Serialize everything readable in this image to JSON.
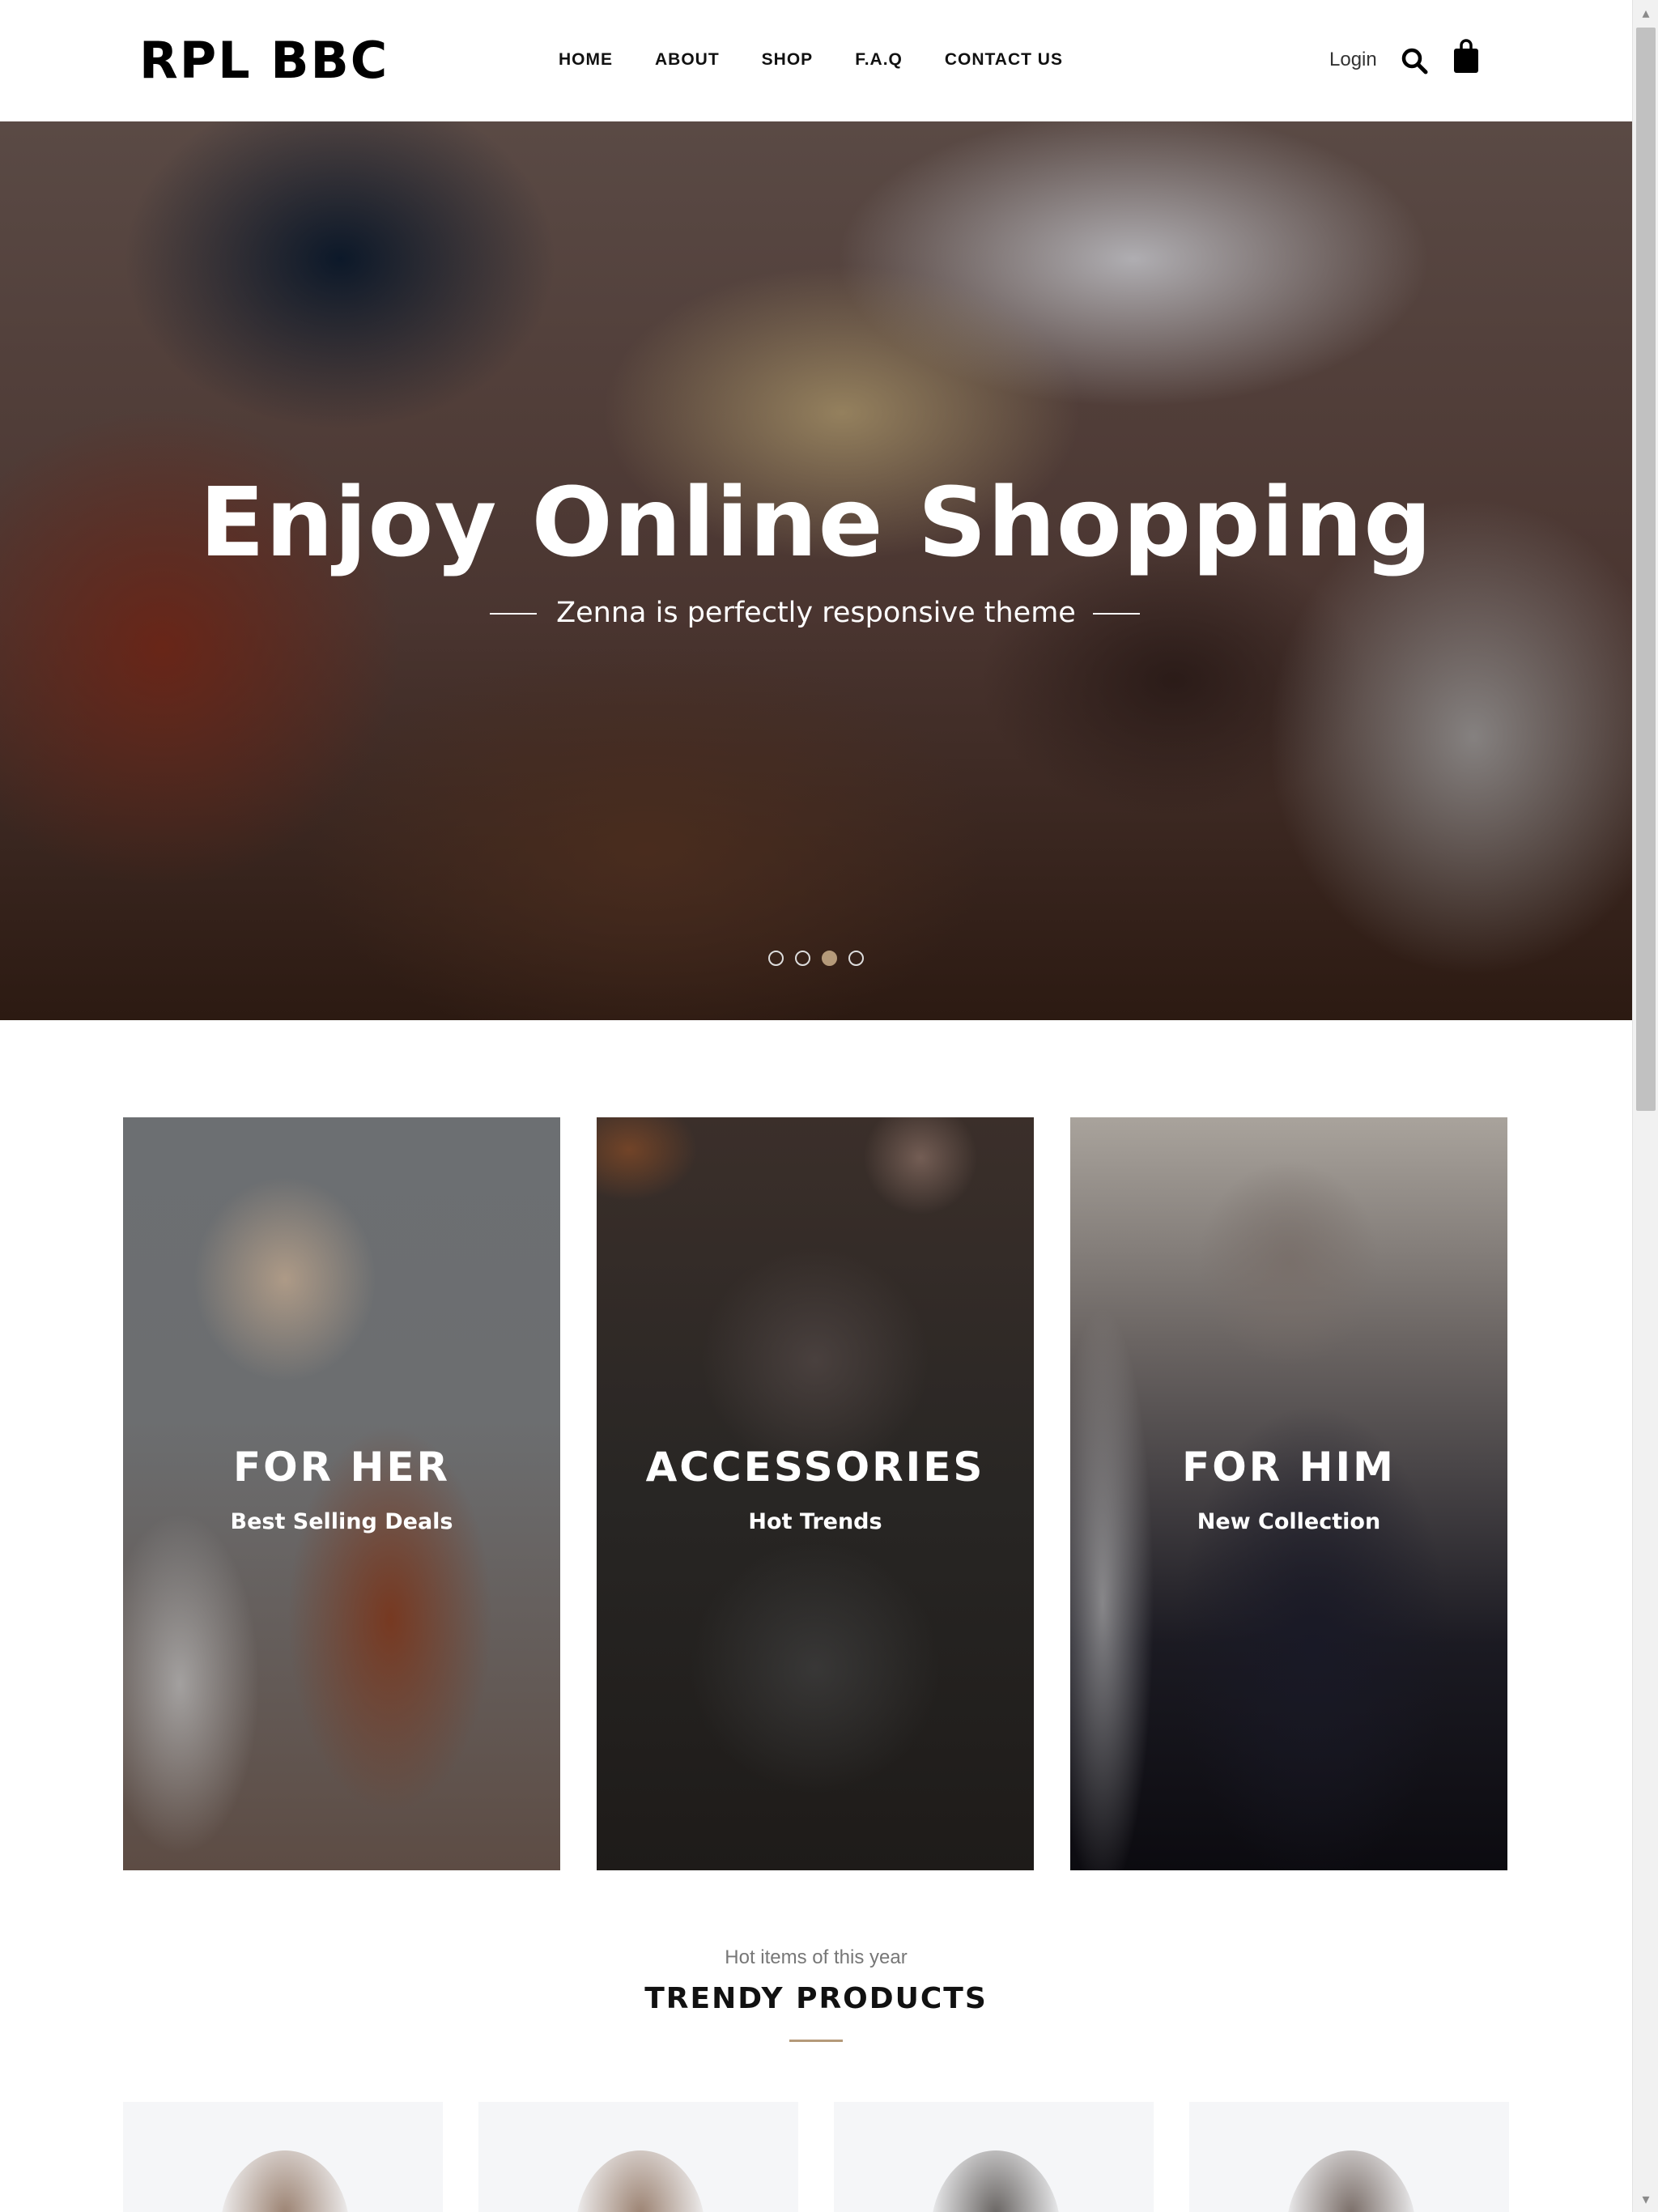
{
  "header": {
    "logo": "RPL BBC",
    "nav": [
      "HOME",
      "ABOUT",
      "SHOP",
      "F.A.Q",
      "CONTACT US"
    ],
    "login": "Login",
    "icons": {
      "search": "search-icon",
      "cart": "shopping-bag-icon"
    }
  },
  "hero": {
    "title": "Enjoy Online Shopping",
    "subtitle": "Zenna is perfectly responsive theme",
    "slides": 4,
    "active_slide": 3
  },
  "categories": [
    {
      "title": "FOR HER",
      "subtitle": "Best Selling Deals"
    },
    {
      "title": "ACCESSORIES",
      "subtitle": "Hot Trends"
    },
    {
      "title": "FOR HIM",
      "subtitle": "New Collection"
    }
  ],
  "trendy": {
    "kicker": "Hot items of this year",
    "title": "TRENDY PRODUCTS"
  },
  "colors": {
    "accent": "#b59a7a",
    "text": "#111111",
    "muted": "#777777"
  }
}
